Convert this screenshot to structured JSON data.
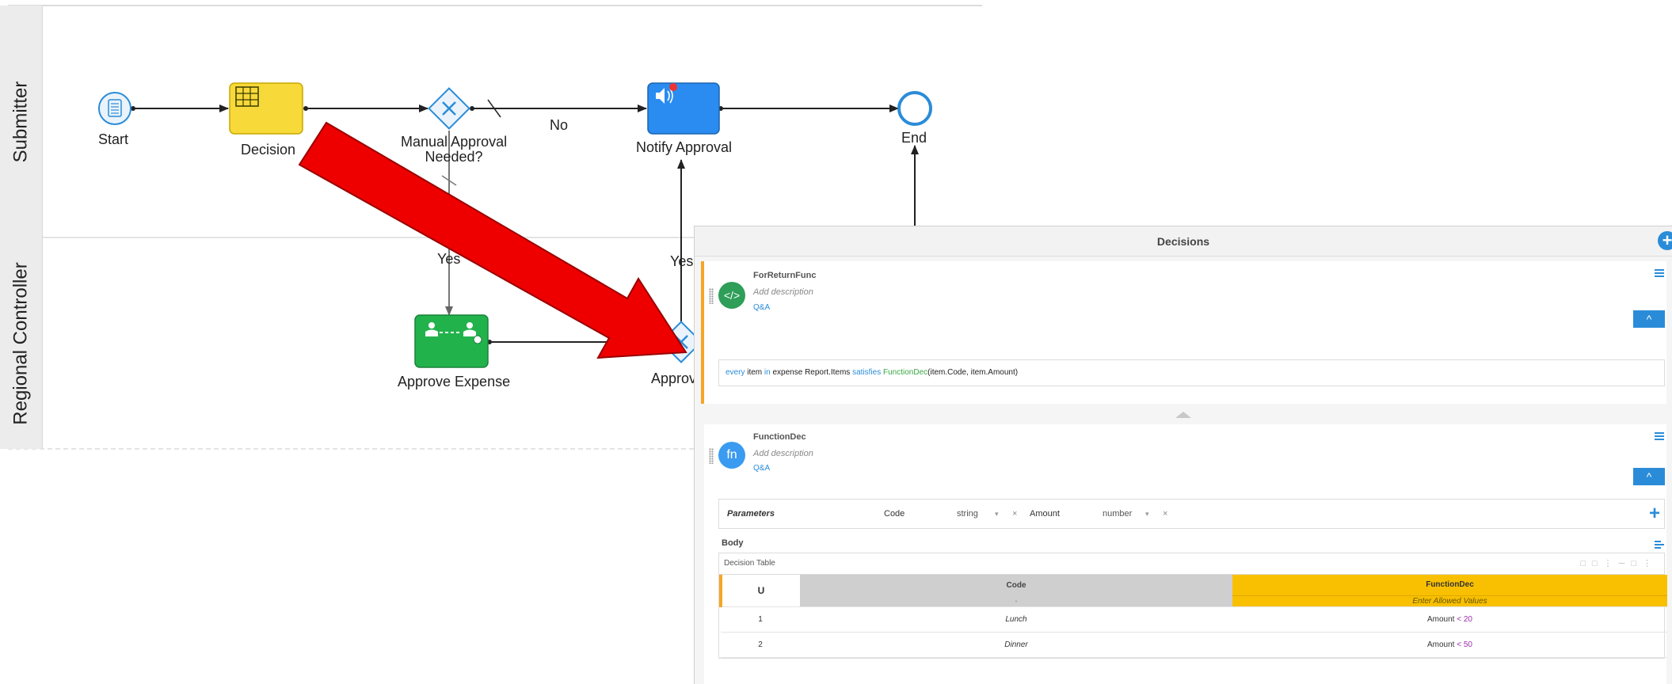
{
  "lanes": {
    "submitter": "Submitter",
    "regional_controller": "Regional Controller"
  },
  "nodes": {
    "start": "Start",
    "decision": "Decision",
    "manual_approval_line1": "Manual Approval",
    "manual_approval_line2": "Needed?",
    "notify_approval": "Notify Approval",
    "end": "End",
    "approve_expense": "Approve Expense",
    "approv_partial": "Approv"
  },
  "flows": {
    "no": "No",
    "yes1": "Yes",
    "yes2": "Yes"
  },
  "colors": {
    "decision_task": "#f7d93a",
    "notify_task": "#2a8cf0",
    "approve_task": "#22b24c",
    "arrow": "#ee0000",
    "accent": "#2a8cd8"
  },
  "decisions_panel": {
    "title": "Decisions",
    "card1": {
      "name": "ForReturnFunc",
      "description": "Add description",
      "qa": "Q&A",
      "expr_every": "every",
      "expr_item": " item ",
      "expr_in": "in",
      "expr_source": " expense Report.Items ",
      "expr_satisfies": "satisfies",
      "expr_func": " FunctionDec",
      "expr_args": "(item.Code, item.Amount)"
    },
    "card2": {
      "name": "FunctionDec",
      "description": "Add description",
      "qa": "Q&A",
      "params_label": "Parameters",
      "param1_name": "Code",
      "param1_type": "string",
      "param2_name": "Amount",
      "param2_type": "number",
      "body_label": "Body",
      "table_title": "Decision Table",
      "hit_policy": "U",
      "col_code": "Code",
      "col_code_sub": "-",
      "col_out": "FunctionDec",
      "col_out_sub": "Enter Allowed Values",
      "rows": [
        {
          "num": "1",
          "code": "Lunch",
          "out_var": "Amount",
          "out_op": "<",
          "out_val": "20"
        },
        {
          "num": "2",
          "code": "Dinner",
          "out_var": "Amount",
          "out_op": "<",
          "out_val": "50"
        }
      ]
    }
  }
}
